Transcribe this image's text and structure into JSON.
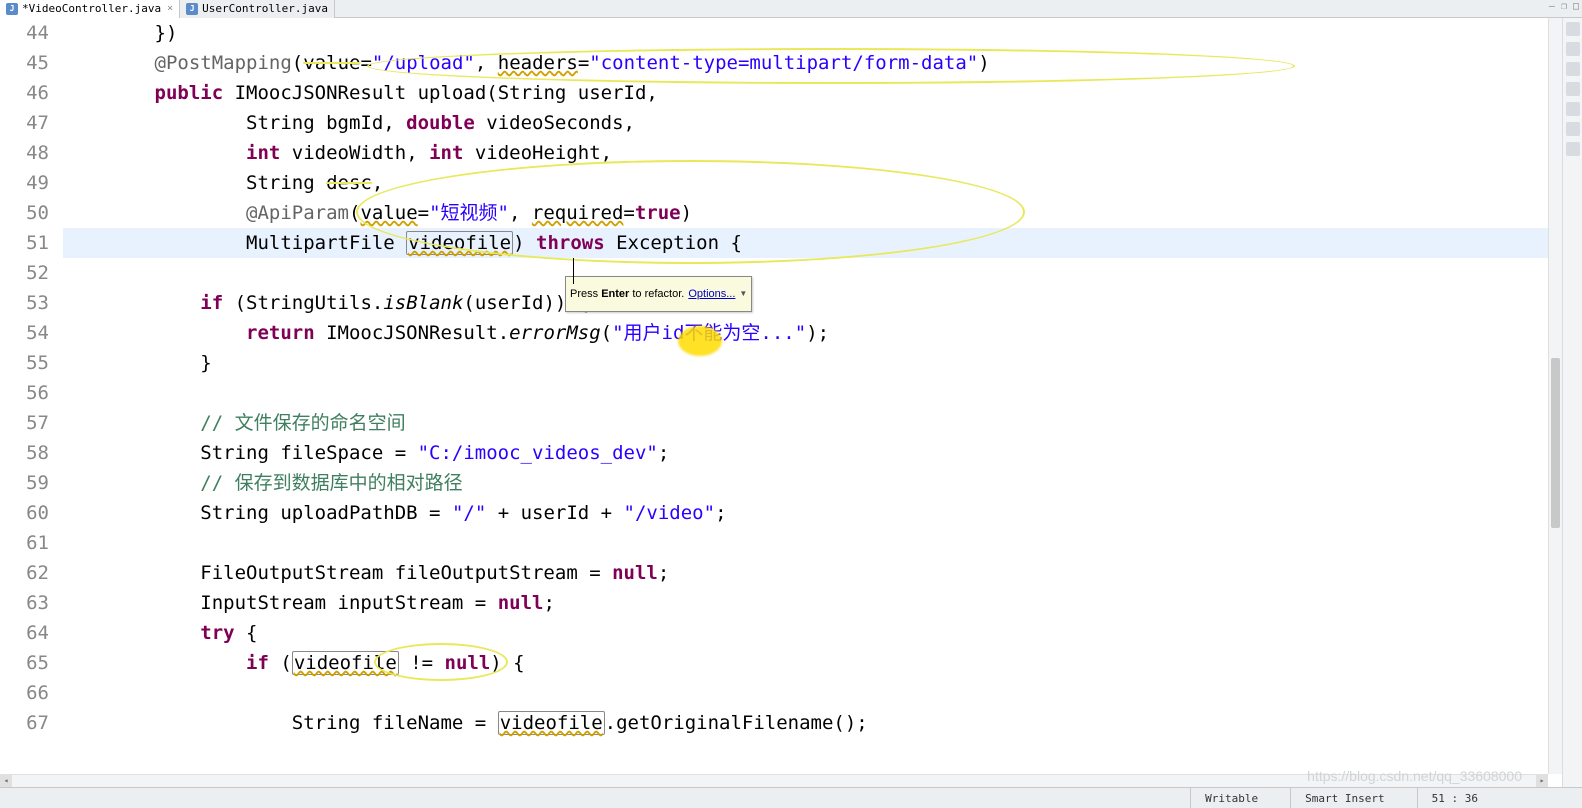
{
  "tabs": [
    {
      "name": "*VideoController.java",
      "active": true,
      "dirty": true
    },
    {
      "name": "UserController.java",
      "active": false,
      "dirty": false
    }
  ],
  "lines": [
    44,
    45,
    46,
    47,
    48,
    49,
    50,
    51,
    52,
    53,
    54,
    55,
    56,
    57,
    58,
    59,
    60,
    61,
    62,
    63,
    64,
    65,
    66,
    67
  ],
  "code": {
    "44": {
      "segs": [
        {
          "t": "        })",
          "c": ""
        }
      ]
    },
    "45": {
      "segs": [
        {
          "t": "        ",
          "c": ""
        },
        {
          "t": "@PostMapping",
          "c": "ann"
        },
        {
          "t": "(",
          "c": ""
        },
        {
          "t": "value",
          "c": "err strike"
        },
        {
          "t": "=",
          "c": ""
        },
        {
          "t": "\"/upload\"",
          "c": "str"
        },
        {
          "t": ", ",
          "c": ""
        },
        {
          "t": "headers",
          "c": "err"
        },
        {
          "t": "=",
          "c": ""
        },
        {
          "t": "\"content-type=multipart/form-data\"",
          "c": "str"
        },
        {
          "t": ")",
          "c": ""
        }
      ]
    },
    "46": {
      "segs": [
        {
          "t": "        ",
          "c": ""
        },
        {
          "t": "public",
          "c": "kw"
        },
        {
          "t": " IMoocJSONResult upload(String userId,",
          "c": ""
        }
      ]
    },
    "47": {
      "segs": [
        {
          "t": "                String bgmId, ",
          "c": ""
        },
        {
          "t": "double",
          "c": "kw"
        },
        {
          "t": " videoSeconds,",
          "c": ""
        }
      ]
    },
    "48": {
      "segs": [
        {
          "t": "                ",
          "c": ""
        },
        {
          "t": "int",
          "c": "kw"
        },
        {
          "t": " videoWidth, ",
          "c": ""
        },
        {
          "t": "int",
          "c": "kw"
        },
        {
          "t": " videoHeight,",
          "c": ""
        }
      ]
    },
    "49": {
      "segs": [
        {
          "t": "                String ",
          "c": ""
        },
        {
          "t": "desc",
          "c": "strike"
        },
        {
          "t": ",",
          "c": ""
        }
      ]
    },
    "50": {
      "segs": [
        {
          "t": "                ",
          "c": ""
        },
        {
          "t": "@ApiParam",
          "c": "ann"
        },
        {
          "t": "(",
          "c": ""
        },
        {
          "t": "value",
          "c": "err"
        },
        {
          "t": "=",
          "c": ""
        },
        {
          "t": "\"短视频\"",
          "c": "str"
        },
        {
          "t": ", ",
          "c": ""
        },
        {
          "t": "required",
          "c": "err"
        },
        {
          "t": "=",
          "c": ""
        },
        {
          "t": "true",
          "c": "kw"
        },
        {
          "t": ")",
          "c": ""
        }
      ]
    },
    "51": {
      "segs": [
        {
          "t": "                MultipartFile ",
          "c": ""
        },
        {
          "t": "videofile",
          "c": "err boxed"
        },
        {
          "t": ") ",
          "c": ""
        },
        {
          "t": "throws",
          "c": "kw"
        },
        {
          "t": " Exception {",
          "c": ""
        }
      ]
    },
    "52": {
      "segs": [
        {
          "t": "",
          "c": ""
        }
      ]
    },
    "53": {
      "segs": [
        {
          "t": "            ",
          "c": ""
        },
        {
          "t": "if",
          "c": "kw"
        },
        {
          "t": " (StringUtils.",
          "c": ""
        },
        {
          "t": "isBlank",
          "c": "italic"
        },
        {
          "t": "(userId)) {",
          "c": ""
        }
      ]
    },
    "54": {
      "segs": [
        {
          "t": "                ",
          "c": ""
        },
        {
          "t": "return",
          "c": "kw"
        },
        {
          "t": " IMoocJSONResult.",
          "c": ""
        },
        {
          "t": "errorMsg",
          "c": "italic"
        },
        {
          "t": "(",
          "c": ""
        },
        {
          "t": "\"用户id不能为空...\"",
          "c": "str"
        },
        {
          "t": ");",
          "c": ""
        }
      ]
    },
    "55": {
      "segs": [
        {
          "t": "            }",
          "c": ""
        }
      ]
    },
    "56": {
      "segs": [
        {
          "t": "",
          "c": ""
        }
      ]
    },
    "57": {
      "segs": [
        {
          "t": "            ",
          "c": ""
        },
        {
          "t": "// 文件保存的命名空间",
          "c": "cmt"
        }
      ]
    },
    "58": {
      "segs": [
        {
          "t": "            String fileSpace = ",
          "c": ""
        },
        {
          "t": "\"C:/imooc_videos_dev\"",
          "c": "str"
        },
        {
          "t": ";",
          "c": ""
        }
      ]
    },
    "59": {
      "segs": [
        {
          "t": "            ",
          "c": ""
        },
        {
          "t": "// 保存到数据库中的相对路径",
          "c": "cmt"
        }
      ]
    },
    "60": {
      "segs": [
        {
          "t": "            String uploadPathDB = ",
          "c": ""
        },
        {
          "t": "\"/\"",
          "c": "str"
        },
        {
          "t": " + userId + ",
          "c": ""
        },
        {
          "t": "\"/video\"",
          "c": "str"
        },
        {
          "t": ";",
          "c": ""
        }
      ]
    },
    "61": {
      "segs": [
        {
          "t": "",
          "c": ""
        }
      ]
    },
    "62": {
      "segs": [
        {
          "t": "            FileOutputStream fileOutputStream = ",
          "c": ""
        },
        {
          "t": "null",
          "c": "kw"
        },
        {
          "t": ";",
          "c": ""
        }
      ]
    },
    "63": {
      "segs": [
        {
          "t": "            InputStream inputStream = ",
          "c": ""
        },
        {
          "t": "null",
          "c": "kw"
        },
        {
          "t": ";",
          "c": ""
        }
      ]
    },
    "64": {
      "segs": [
        {
          "t": "            ",
          "c": ""
        },
        {
          "t": "try",
          "c": "kw"
        },
        {
          "t": " {",
          "c": ""
        }
      ]
    },
    "65": {
      "segs": [
        {
          "t": "                ",
          "c": ""
        },
        {
          "t": "if",
          "c": "kw"
        },
        {
          "t": " (",
          "c": ""
        },
        {
          "t": "videofile",
          "c": "err boxed"
        },
        {
          "t": " != ",
          "c": ""
        },
        {
          "t": "null",
          "c": "kw"
        },
        {
          "t": ") {",
          "c": ""
        }
      ]
    },
    "66": {
      "segs": [
        {
          "t": "",
          "c": ""
        }
      ]
    },
    "67": {
      "segs": [
        {
          "t": "                    String fileName = ",
          "c": ""
        },
        {
          "t": "videofile",
          "c": "err boxed"
        },
        {
          "t": ".getOriginalFilename();",
          "c": ""
        }
      ]
    }
  },
  "tooltip": {
    "pre": "Press ",
    "bold": "Enter",
    "post": " to refactor.",
    "opts": "Options...",
    "dd": "▼"
  },
  "status": {
    "writable": "Writable",
    "insert": "Smart Insert",
    "pos": "51 : 36"
  },
  "watermark": "https://blog.csdn.net/qq_33608000",
  "cursor_line": 51
}
